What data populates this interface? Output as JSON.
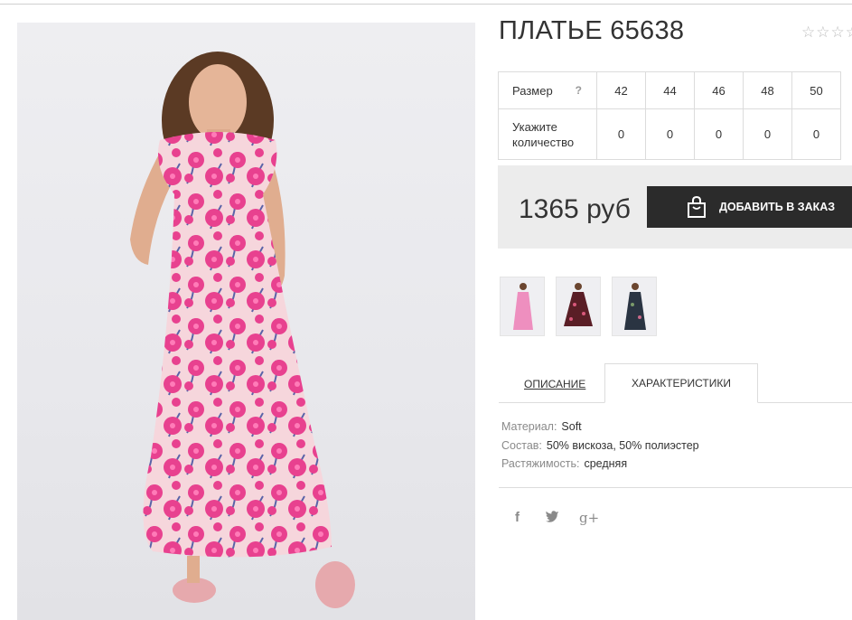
{
  "product": {
    "title": "ПЛАТЬЕ 65638",
    "rating_stars": "☆☆☆☆"
  },
  "sizes": {
    "size_label": "Размер",
    "help": "?",
    "qty_label_1": "Укажите",
    "qty_label_2": "количество",
    "values": [
      "42",
      "44",
      "46",
      "48",
      "50"
    ],
    "quantities": [
      "0",
      "0",
      "0",
      "0",
      "0"
    ]
  },
  "order": {
    "price": "1365 руб",
    "add_button": "ДОБАВИТЬ В ЗАКАЗ"
  },
  "tabs": {
    "description": "ОПИСАНИЕ",
    "characteristics": "ХАРАКТЕРИСТИКИ"
  },
  "specs": [
    {
      "key": "Материал:",
      "value": "Soft"
    },
    {
      "key": "Состав:",
      "value": "50% вискоза, 50% полиэстер"
    },
    {
      "key": "Растяжимость:",
      "value": "средняя"
    }
  ],
  "social": {
    "facebook": "f",
    "twitter": "🐦",
    "google": "g+"
  },
  "colors": {
    "dress_pink": "#e8418f",
    "button_dark": "#2b2b2b",
    "panel_gray": "#ececec"
  }
}
